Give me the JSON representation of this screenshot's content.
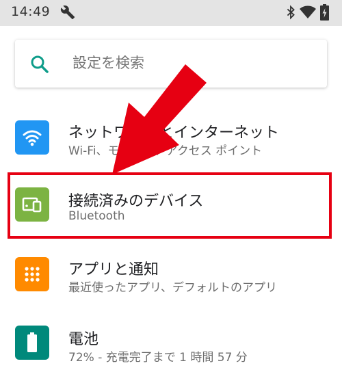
{
  "status_bar": {
    "time": "14:49",
    "icons": [
      "wrench-icon",
      "bluetooth-icon",
      "wifi-signal-icon",
      "battery-charging-icon"
    ]
  },
  "search": {
    "placeholder": "設定を検索"
  },
  "settings_items": [
    {
      "title": "ネットワークとインターネット",
      "subtitle": "Wi-Fi、モバイル、アクセス ポイント",
      "icon": "wifi-icon",
      "color": "#2196f3"
    },
    {
      "title": "接続済みのデバイス",
      "subtitle": "Bluetooth",
      "icon": "devices-icon",
      "color": "#7cb342"
    },
    {
      "title": "アプリと通知",
      "subtitle": "最近使ったアプリ、デフォルトのアプリ",
      "icon": "apps-grid-icon",
      "color": "#ff8a00"
    },
    {
      "title": "電池",
      "subtitle": "72% - 充電完了まで 1 時間 57 分",
      "icon": "battery-icon",
      "color": "#00897b"
    }
  ],
  "annotation": {
    "arrow_color": "#e60012",
    "highlight_color": "#e60012"
  }
}
